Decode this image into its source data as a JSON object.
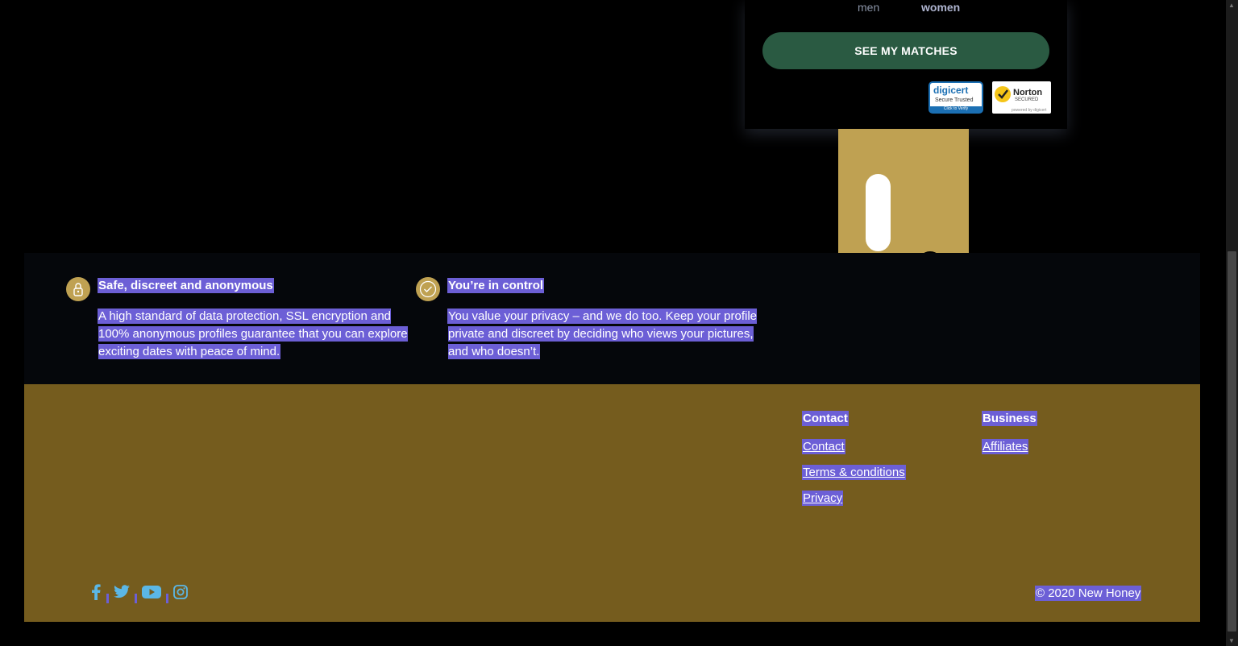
{
  "signup": {
    "gender_men": "men",
    "gender_women": "women",
    "cta_label": "SEE MY MATCHES",
    "badges": {
      "digicert": {
        "name": "digicert",
        "line1": "Secure Trusted",
        "line2": "Click to Verify"
      },
      "norton": {
        "name": "Norton",
        "line1": "SECURED",
        "line2": "powered by digicert"
      }
    }
  },
  "features": [
    {
      "title": "Safe, discreet and anonymous",
      "body": "A high standard of data protection, SSL encryption and 100% anonymous profiles guarantee that you can explore exciting dates with peace of mind.",
      "icon": "lock-icon"
    },
    {
      "title": "You’re in control",
      "body": "You value your privacy – and we do too. Keep your profile private and discreet by deciding who views your pictures, and who doesn’t.",
      "icon": "check-icon"
    }
  ],
  "footer": {
    "contact": {
      "heading": "Contact",
      "links": [
        "Contact",
        "Terms & conditions",
        "Privacy"
      ]
    },
    "business": {
      "heading": "Business",
      "links": [
        "Affiliates"
      ]
    },
    "social": [
      "facebook-icon",
      "twitter-icon",
      "youtube-icon",
      "instagram-icon"
    ],
    "copyright": "© 2020 New Honey"
  },
  "colors": {
    "background": "#000000",
    "cta": "#2a5a42",
    "honey": "#bfa152",
    "footer": "#755c1e",
    "selection": "#6c5fd6",
    "social": "#5bb7e6"
  }
}
